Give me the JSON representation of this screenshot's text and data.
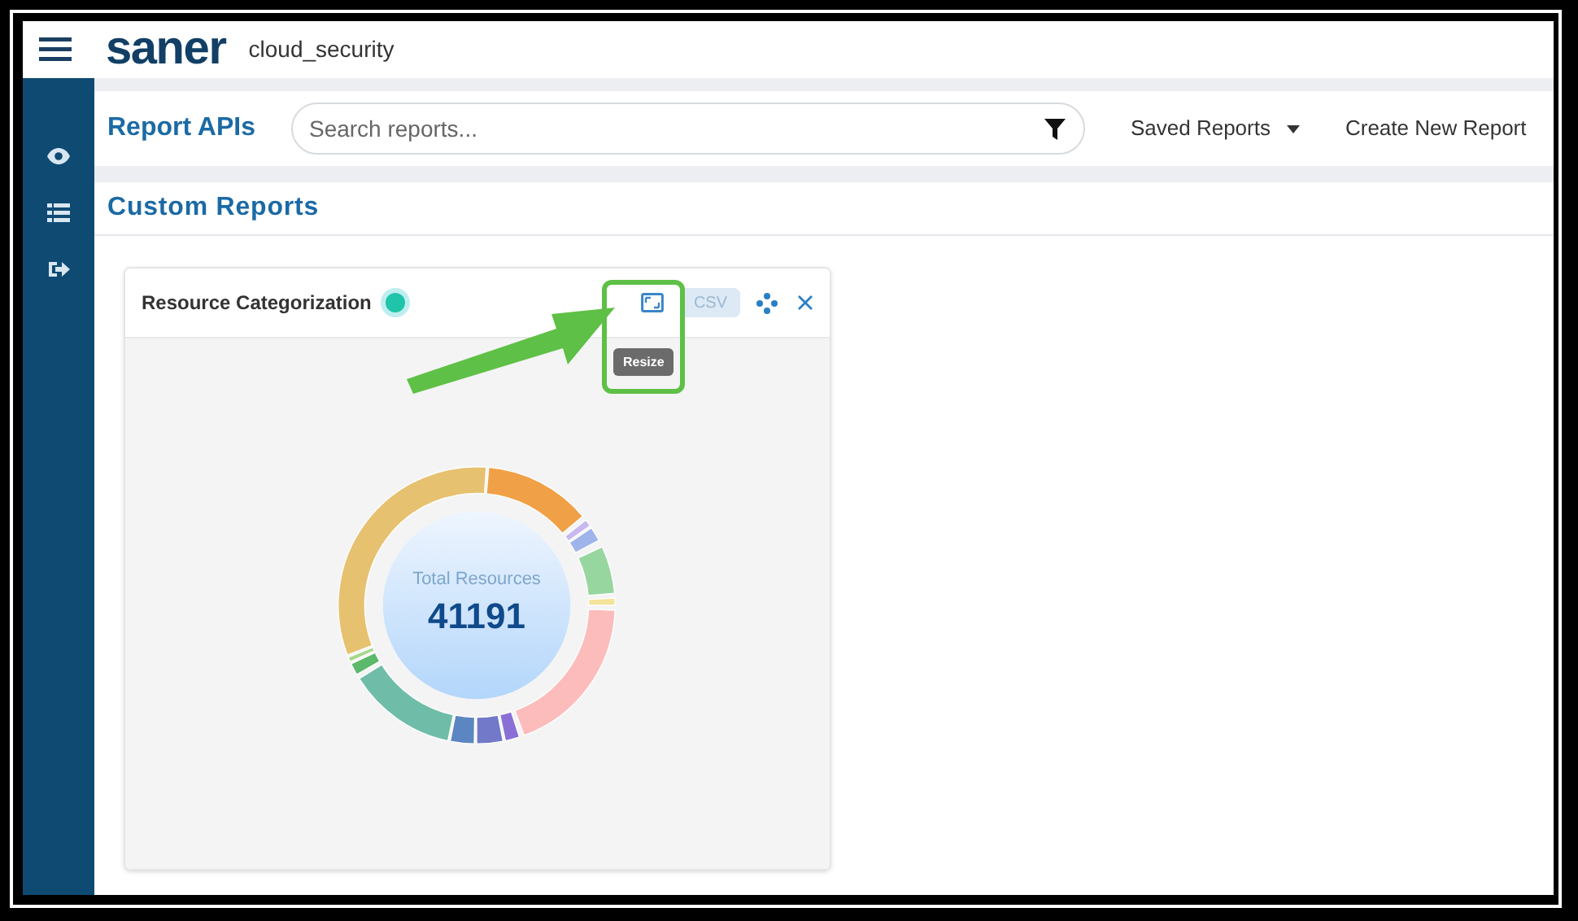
{
  "topbar": {
    "logo": "saner",
    "workspace": "cloud_security"
  },
  "sidebar": {
    "items": [
      {
        "kind": "eye"
      },
      {
        "kind": "list"
      },
      {
        "kind": "logout"
      }
    ]
  },
  "toolbar": {
    "title": "Report APIs",
    "search": {
      "placeholder": "Search reports..."
    },
    "saved_reports": "Saved Reports",
    "create": "Create New Report"
  },
  "section": {
    "title": "Custom Reports"
  },
  "widget": {
    "title": "Resource Categorization",
    "csv": "CSV",
    "tooltip": "Resize",
    "chart": {
      "kind": "picture",
      "center_label": "Total Resources",
      "center_value": "41191"
    }
  },
  "annotation": {
    "kind": "arrow"
  }
}
